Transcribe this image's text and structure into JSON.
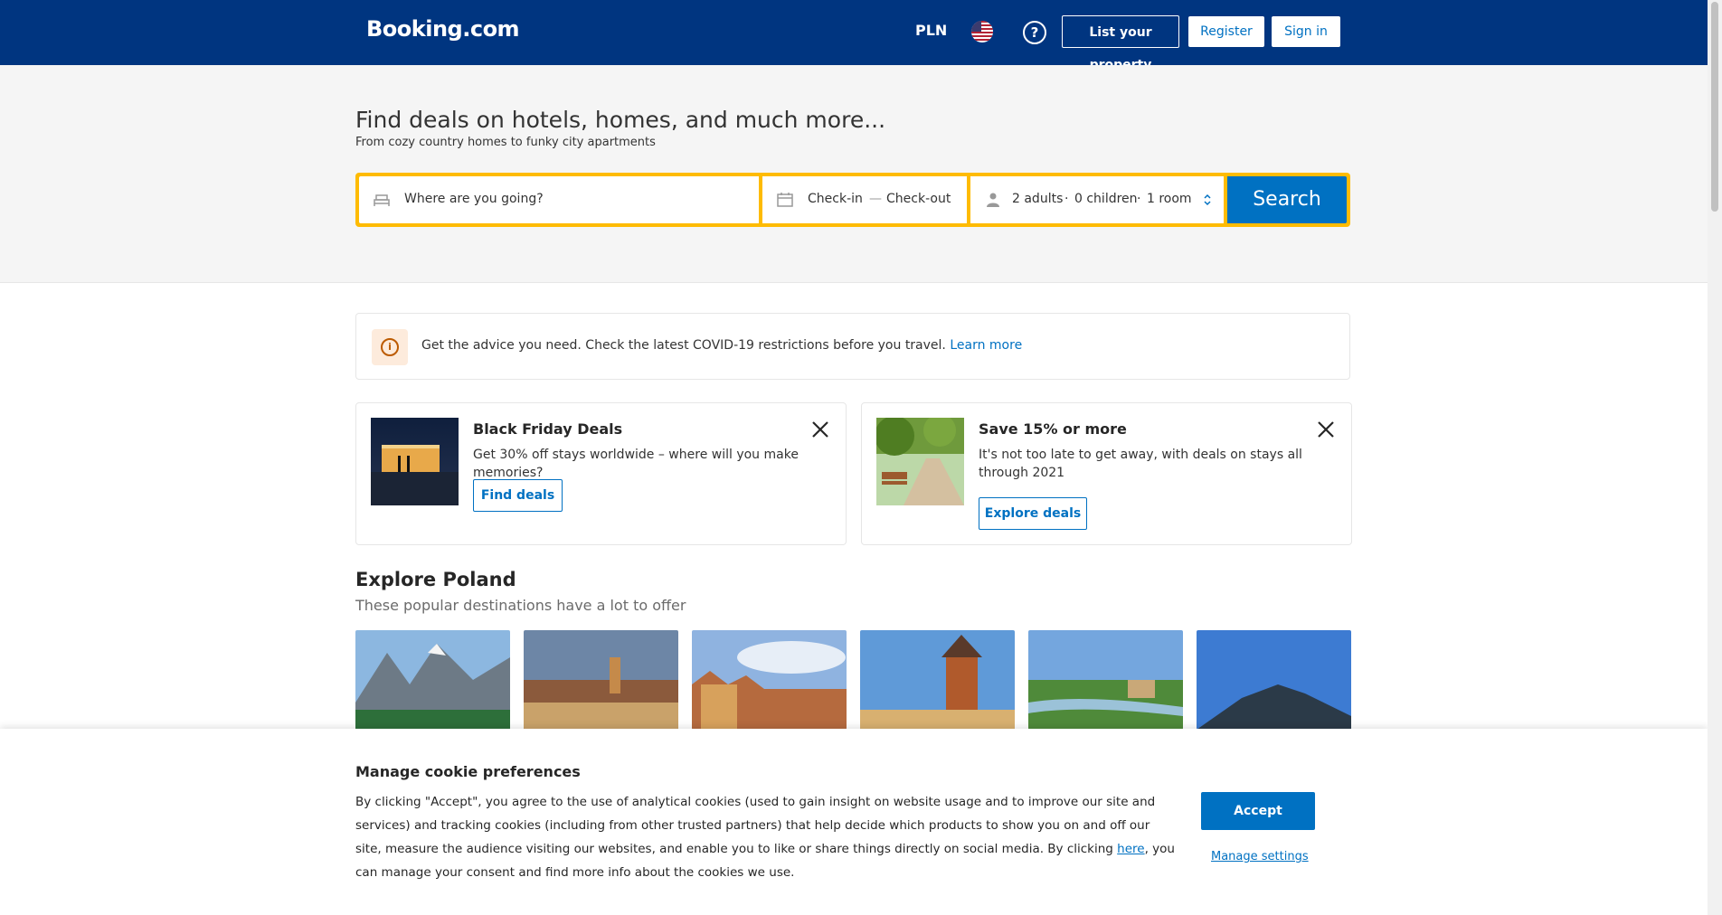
{
  "header": {
    "logo": "Booking.com",
    "currency": "PLN",
    "list_property": "List your property",
    "register": "Register",
    "sign_in": "Sign in"
  },
  "hero": {
    "title": "Find deals on hotels, homes, and much more...",
    "subtitle": "From cozy country homes to funky city apartments"
  },
  "search": {
    "destination_placeholder": "Where are you going?",
    "checkin": "Check-in",
    "separator": "—",
    "checkout": "Check-out",
    "adults": "2 adults",
    "children": "0 children",
    "rooms": "1 room",
    "dot": "·",
    "button": "Search"
  },
  "notice": {
    "text": "Get the advice you need. Check the latest COVID-19 restrictions before you travel.",
    "link": "Learn more"
  },
  "promos": [
    {
      "title": "Black Friday Deals",
      "description": "Get 30% off stays worldwide – where will you make memories?",
      "button": "Find deals"
    },
    {
      "title": "Save 15% or more",
      "description": "It's not too late to get away, with deals on stays all through 2021",
      "button": "Explore deals"
    }
  ],
  "explore": {
    "title": "Explore Poland",
    "subtitle": "These popular destinations have a lot to offer"
  },
  "cookie": {
    "title": "Manage cookie preferences",
    "text_before": "By clicking \"Accept\", you agree to the use of analytical cookies (used to gain insight on website usage and to improve our site and services) and tracking cookies (including from other trusted partners) that help decide which products to show you on and off our site, measure the audience visiting our websites, and enable you to like or share things directly on social media. By clicking ",
    "here": "here",
    "text_after": ", you can manage your consent and find more info about the cookies we use.",
    "accept": "Accept",
    "manage": "Manage settings"
  },
  "colors": {
    "brand_blue": "#003580",
    "action_blue": "#0071c2",
    "search_yellow": "#febb02"
  }
}
